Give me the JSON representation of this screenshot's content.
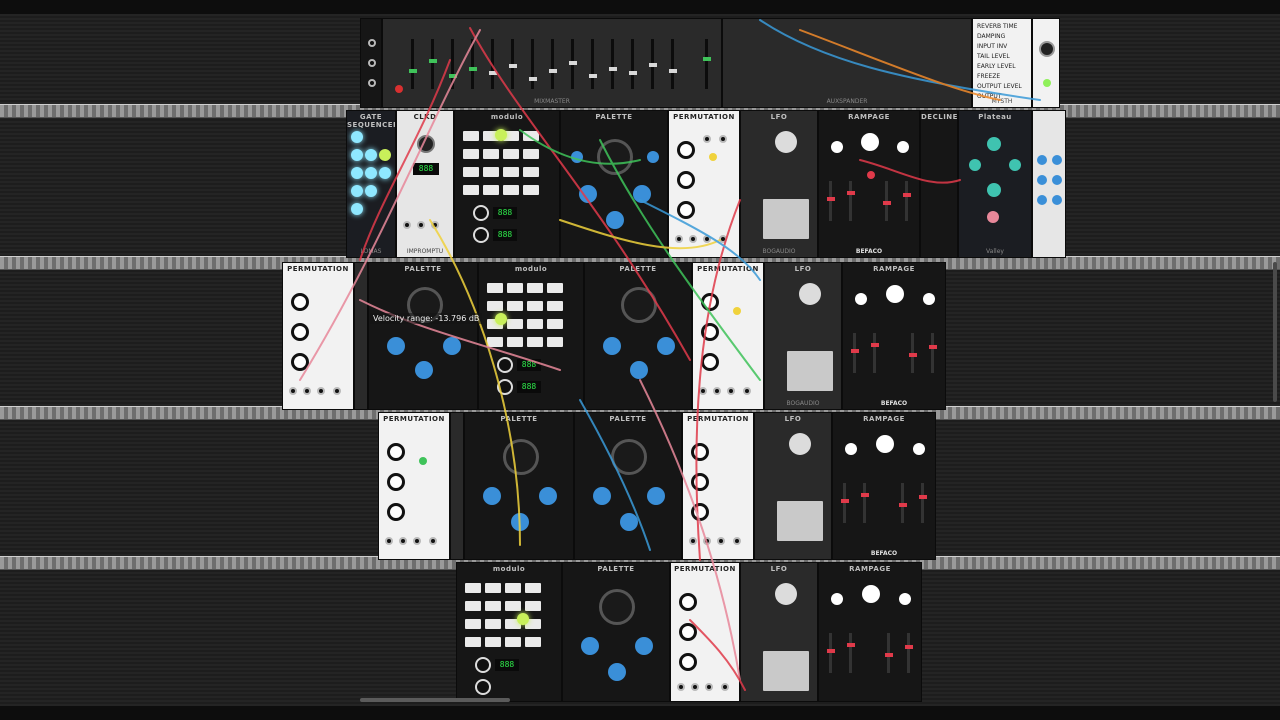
{
  "tooltip": {
    "velocity_range": "Velocity range: -13.796 dB"
  },
  "modules": {
    "gate_sequencer": "GATE SEQUENCER",
    "clkd": "CLKD",
    "modulo": "modulo",
    "palette": "PALETTE",
    "permutation": "PERMUTATION",
    "lfo": "LFO",
    "rampage": "RAMPAGE",
    "decline": "DECLINE",
    "plateau": "Plateau",
    "valley": "Valley",
    "mixmaster": "MIXMASTER",
    "auxspander": "AUXSPANDER",
    "mysth": "MYSTH",
    "bogaudio": "BOGAUDIO",
    "befaco": "BEFACO",
    "impromptu": "IMPROMPTU",
    "lomas": "LOMAS"
  },
  "displays": {
    "seg1": "888",
    "seg2": "888",
    "seg3": "888",
    "seg4": "888",
    "seg5": "888",
    "seg6": "888"
  },
  "reverb_labels": [
    "REVERB TIME",
    "DAMPING",
    "INPUT INV",
    "TAIL LEVEL",
    "EARLY LEVEL",
    "FREEZE",
    "OUTPUT LEVEL",
    "OUTPUT"
  ],
  "colors": {
    "cable_red": "#e03a4a",
    "cable_pink": "#e8889a",
    "cable_yellow": "#f0d23c",
    "cable_green": "#3fc35a",
    "cable_blue": "#3a9ad8",
    "cable_orange": "#f08a2a",
    "knob_blue": "#3a8fd8",
    "led_green": "#8ff05a"
  }
}
